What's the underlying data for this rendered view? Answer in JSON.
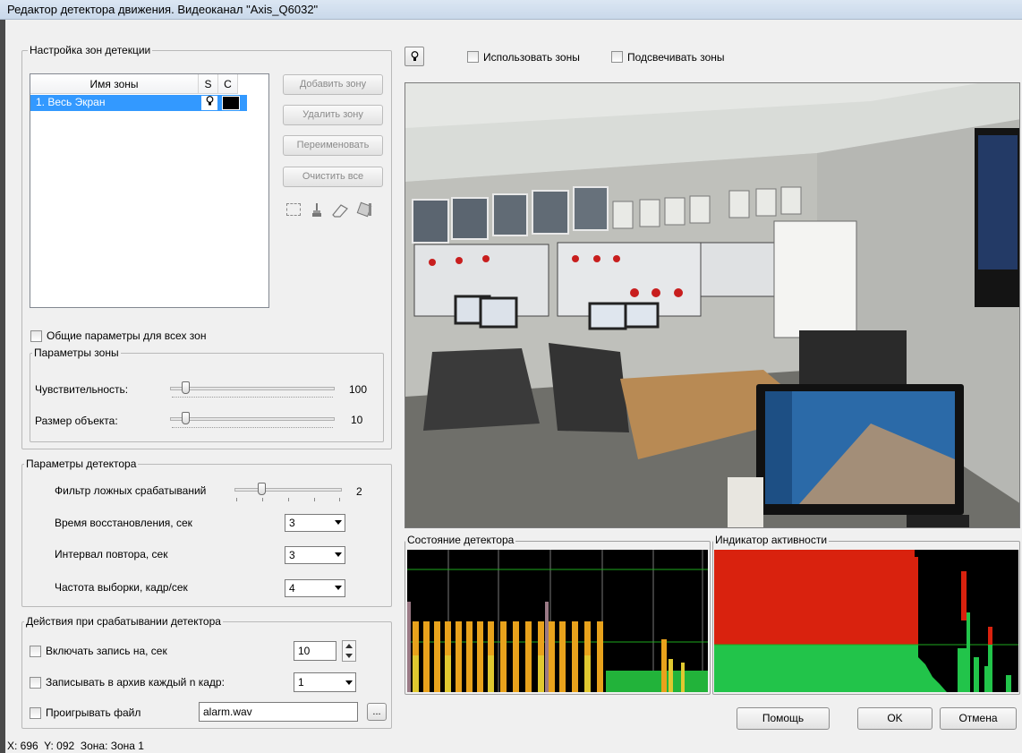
{
  "window": {
    "title": "Редактор детектора движения. Видеоканал \"Axis_Q6032\""
  },
  "zones": {
    "group_title": "Настройка зон детекции",
    "columns": [
      "Имя зоны",
      "S",
      "C"
    ],
    "rows": [
      {
        "name": "1. Весь Экран",
        "selected": true,
        "color": "#000000"
      }
    ],
    "buttons": {
      "add": "Добавить зону",
      "delete": "Удалить зону",
      "rename": "Переименовать",
      "clear": "Очистить все"
    },
    "tools": [
      "select-rect-icon",
      "brush-icon",
      "eraser-icon",
      "fill-icon"
    ]
  },
  "common_params_label": "Общие параметры для всех зон",
  "zone_params": {
    "title": "Параметры зоны",
    "sensitivity_label": "Чувствительность:",
    "sensitivity_value": "100",
    "object_size_label": "Размер объекта:",
    "object_size_value": "10"
  },
  "detector_params": {
    "title": "Параметры детектора",
    "filter_label": "Фильтр ложных срабатываний",
    "filter_value": "2",
    "recovery_label": "Время восстановления, сек",
    "recovery_value": "3",
    "repeat_label": "Интервал повтора, сек",
    "repeat_value": "3",
    "fps_label": "Частота выборки, кадр/сек",
    "fps_value": "4"
  },
  "actions": {
    "title": "Действия при срабатывании детектора",
    "record_label": "Включать запись на, сек",
    "record_value": "10",
    "archive_label": "Записывать в архив каждый n кадр:",
    "archive_value": "1",
    "play_label": "Проигрывать файл",
    "play_value": "alarm.wav",
    "browse_label": "..."
  },
  "view_toolbar": {
    "use_zones_label": "Использовать зоны",
    "highlight_zones_label": "Подсвечивать зоны"
  },
  "detector_state": {
    "title": "Состояние детектора",
    "colors": {
      "grid": "#1a8a1a",
      "bar_orange": "#e8a21c",
      "bar_yellow": "#e0c830",
      "fill_green": "#22b33a"
    }
  },
  "activity": {
    "title": "Индикатор активности",
    "colors": {
      "red": "#d9220e",
      "green": "#22c44a"
    }
  },
  "footer_buttons": {
    "help": "Помощь",
    "ok": "OK",
    "cancel": "Отмена"
  },
  "status_bar": "X: 696  Y: 092  Зона: Зона 1"
}
